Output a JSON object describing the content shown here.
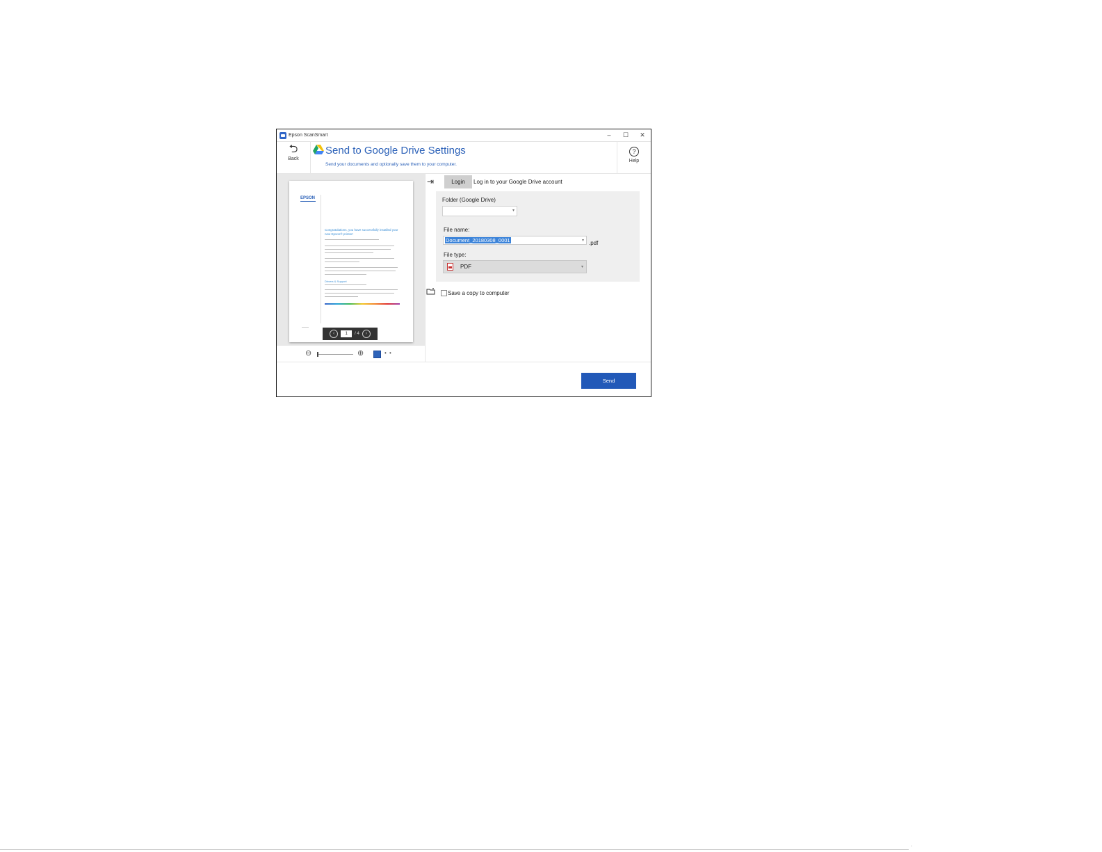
{
  "window": {
    "title": "Epson ScanSmart",
    "controls": {
      "minimize": "–",
      "maximize": "☐",
      "close": "✕"
    }
  },
  "header": {
    "back_label": "Back",
    "title": "Send to Google Drive Settings",
    "subtitle": "Send your documents and optionally save them to your computer.",
    "help_label": "Help"
  },
  "preview": {
    "logo_text": "EPSON",
    "heading": "Congratulations, you have successfully installed your new Epson® printer!",
    "subheading": "Drivers & Support",
    "page_current": "1",
    "page_total": "/ 4",
    "prev_glyph": "‹",
    "next_glyph": "›"
  },
  "zoom": {
    "out_glyph": "⊖",
    "in_glyph": "⊕",
    "dots": "•  •"
  },
  "settings": {
    "login_button": "Login",
    "login_text": "Log in to your Google Drive account",
    "folder_label": "Folder (Google Drive)",
    "folder_value": "",
    "file_name_label": "File name:",
    "file_name_value": "Document_20180308_0001",
    "file_ext": ".pdf",
    "file_type_label": "File type:",
    "file_type_value": "PDF",
    "save_copy_label": "Save a copy to computer",
    "save_copy_checked": false
  },
  "footer": {
    "send_button": "Send"
  },
  "colors": {
    "accent": "#2e63b9",
    "send": "#2259b8",
    "selection": "#3b83d9"
  },
  "icons": [
    "back-arrow-icon",
    "google-drive-icon",
    "help-icon",
    "login-icon",
    "zoom-out-icon",
    "zoom-in-icon",
    "fit-page-icon",
    "pdf-icon",
    "folder-save-icon"
  ]
}
